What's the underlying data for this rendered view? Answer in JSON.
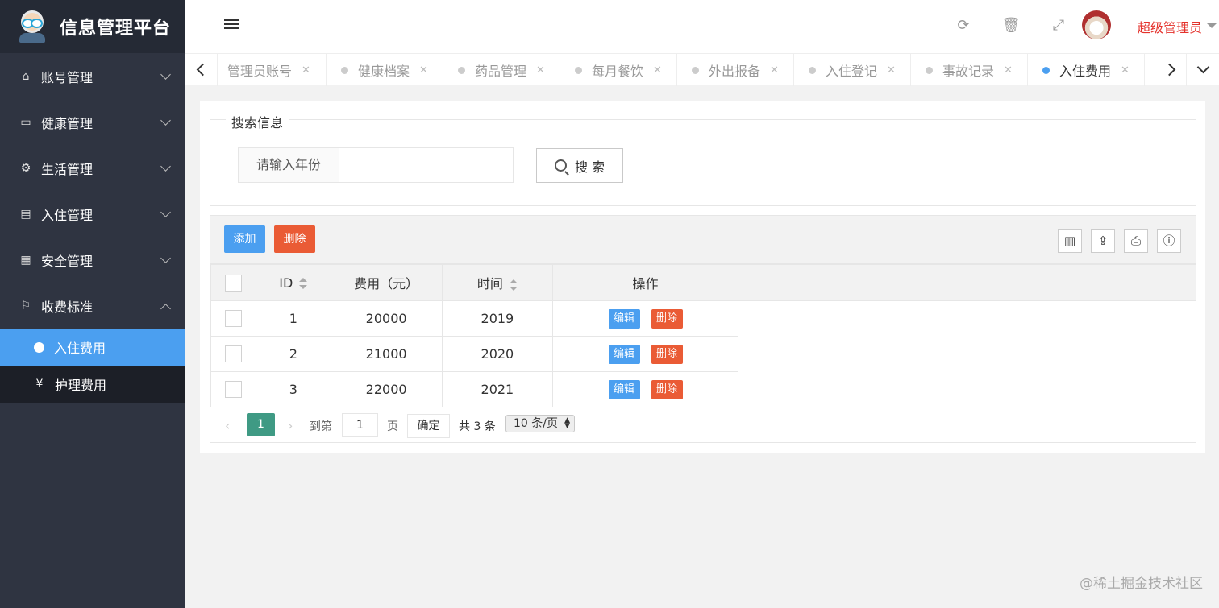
{
  "app": {
    "title": "信息管理平台"
  },
  "sidebar": {
    "items": [
      {
        "label": "账号管理",
        "icon": "home-icon"
      },
      {
        "label": "健康管理",
        "icon": "window-icon"
      },
      {
        "label": "生活管理",
        "icon": "gears-icon"
      },
      {
        "label": "入住管理",
        "icon": "file-icon"
      },
      {
        "label": "安全管理",
        "icon": "calendar-icon"
      },
      {
        "label": "收费标准",
        "icon": "flag-icon",
        "expanded": true
      }
    ],
    "subitems": [
      {
        "label": "入住费用",
        "icon": "coin-icon",
        "active": true
      },
      {
        "label": "护理费用",
        "icon": "yen-icon",
        "glyph": "¥"
      }
    ]
  },
  "header": {
    "user_name": "超级管理员"
  },
  "tabs": [
    {
      "label": "管理员账号"
    },
    {
      "label": "健康档案"
    },
    {
      "label": "药品管理"
    },
    {
      "label": "每月餐饮"
    },
    {
      "label": "外出报备"
    },
    {
      "label": "入住登记"
    },
    {
      "label": "事故记录"
    },
    {
      "label": "入住费用",
      "active": true
    }
  ],
  "search": {
    "legend": "搜索信息",
    "input_label": "请输入年份",
    "input_value": "",
    "button_label": "搜 索"
  },
  "toolbar": {
    "add_label": "添加",
    "delete_label": "删除"
  },
  "table": {
    "columns": [
      "ID",
      "费用（元）",
      "时间",
      "操作"
    ],
    "edit_label": "编辑",
    "delete_label": "删除",
    "rows": [
      {
        "id": "1",
        "fee": "20000",
        "year": "2019"
      },
      {
        "id": "2",
        "fee": "21000",
        "year": "2020"
      },
      {
        "id": "3",
        "fee": "22000",
        "year": "2021"
      }
    ]
  },
  "pagination": {
    "current_page": "1",
    "goto_label": "到第",
    "page_input": "1",
    "page_unit": "页",
    "confirm_label": "确定",
    "total_label": "共 3 条",
    "page_size": "10 条/页"
  },
  "watermark": "@稀土掘金技术社区",
  "colors": {
    "sidebar": "#2f3441",
    "accent": "#4b9ff0",
    "danger": "#ea5b35",
    "pager": "#3f9a84",
    "user": "#e4322c"
  }
}
